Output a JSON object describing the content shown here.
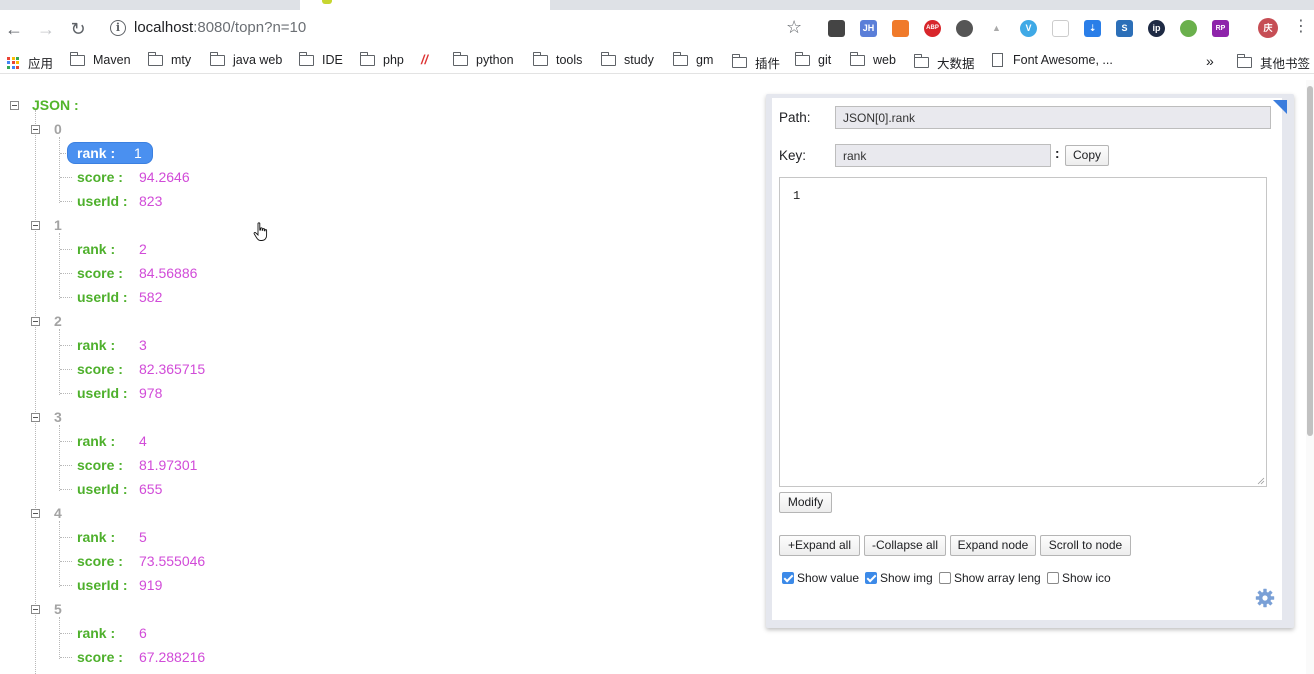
{
  "browser": {
    "url_host": "localhost",
    "url_rest": ":8080/topn?n=10",
    "bookmarks": [
      "应用",
      "Maven",
      "mty",
      "java web",
      "IDE",
      "php",
      "python",
      "tools",
      "study",
      "gm",
      "插件",
      "git",
      "web",
      "大数据",
      "Font Awesome, ...",
      "其他书签"
    ],
    "overflow": "»",
    "ext_labels": {
      "jh": "JH",
      "abp": "ABP",
      "profile": "庆",
      "rp": "RP"
    }
  },
  "tree": {
    "root_label": "JSON :",
    "records": [
      {
        "index": "0",
        "rank": "1",
        "score": "94.2646",
        "userId": "823"
      },
      {
        "index": "1",
        "rank": "2",
        "score": "84.56886",
        "userId": "582"
      },
      {
        "index": "2",
        "rank": "3",
        "score": "82.365715",
        "userId": "978"
      },
      {
        "index": "3",
        "rank": "4",
        "score": "81.97301",
        "userId": "655"
      },
      {
        "index": "4",
        "rank": "5",
        "score": "73.555046",
        "userId": "919"
      },
      {
        "index": "5",
        "rank": "6",
        "score": "67.288216"
      }
    ],
    "keys": {
      "rank": "rank :",
      "score": "score :",
      "userId": "userId :"
    }
  },
  "panel": {
    "path_label": "Path:",
    "path_value": "JSON[0].rank",
    "key_label": "Key:",
    "key_value": "rank",
    "colon": ":",
    "copy_label": "Copy",
    "editor_value": "1",
    "modify_label": "Modify",
    "expand_all_label": "+Expand all",
    "collapse_all_label": "-Collapse all",
    "expand_node_label": "Expand node",
    "scroll_to_node_label": "Scroll to node",
    "options": [
      {
        "label": "Show value",
        "checked": true
      },
      {
        "label": "Show img",
        "checked": true
      },
      {
        "label": "Show array leng",
        "checked": false
      },
      {
        "label": "Show ico",
        "checked": false
      }
    ]
  },
  "colors": {
    "key_green": "#4eb02c",
    "value_magenta": "#d14bd8",
    "selection_blue": "#4a90f0",
    "index_gray": "#a3a3a3"
  }
}
